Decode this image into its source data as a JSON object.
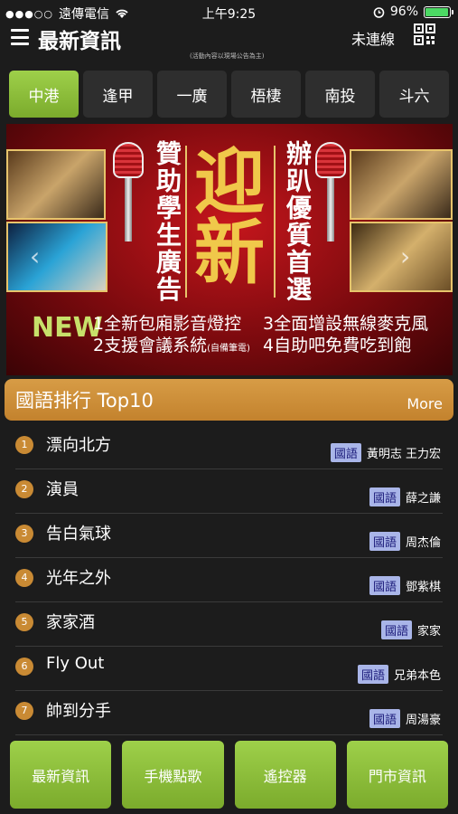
{
  "status_bar": {
    "signal_dots": "●●●○○",
    "carrier": "遠傳電信",
    "time": "上午9:25",
    "battery": "96%",
    "battery_level": 0.96
  },
  "header": {
    "title": "最新資訊",
    "note": "(活動內容以現場公告為主)",
    "connection_status": "未連線"
  },
  "tabs": [
    {
      "label": "中港",
      "active": true
    },
    {
      "label": "逢甲",
      "active": false
    },
    {
      "label": "一廣",
      "active": false
    },
    {
      "label": "梧棲",
      "active": false
    },
    {
      "label": "南投",
      "active": false
    },
    {
      "label": "斗六",
      "active": false
    }
  ],
  "banner": {
    "left_vertical": "贊助學生廣告",
    "main_char_1": "迎",
    "main_char_2": "新",
    "right_vertical": "辦趴優質首選",
    "new_tag": "NEW",
    "feature_1": "1全新包廂影音燈控",
    "feature_2a": "2支援會議系統",
    "feature_2b": "(自備筆電)",
    "feature_3": "3全面增設無線麥克風",
    "feature_4": "4自助吧免費吃到飽",
    "prev": "‹",
    "next": "›"
  },
  "ranking": {
    "title": "國語排行 Top10",
    "more": "More",
    "items": [
      {
        "rank": "1",
        "song": "漂向北方",
        "lang": "國語",
        "artist": "黃明志 王力宏"
      },
      {
        "rank": "2",
        "song": "演員",
        "lang": "國語",
        "artist": "薛之謙"
      },
      {
        "rank": "3",
        "song": "告白氣球",
        "lang": "國語",
        "artist": "周杰倫"
      },
      {
        "rank": "4",
        "song": "光年之外",
        "lang": "國語",
        "artist": "鄧紫棋"
      },
      {
        "rank": "5",
        "song": "家家酒",
        "lang": "國語",
        "artist": "家家"
      },
      {
        "rank": "6",
        "song": "Fly Out",
        "lang": "國語",
        "artist": "兄弟本色"
      },
      {
        "rank": "7",
        "song": "帥到分手",
        "lang": "國語",
        "artist": "周湯豪"
      }
    ]
  },
  "bottom_nav": [
    {
      "label": "最新資訊"
    },
    {
      "label": "手機點歌"
    },
    {
      "label": "遙控器"
    },
    {
      "label": "門市資訊"
    }
  ],
  "colors": {
    "accent_green": "#8ec03c",
    "rank_header": "#cf923d",
    "background": "#1c1c1c"
  }
}
